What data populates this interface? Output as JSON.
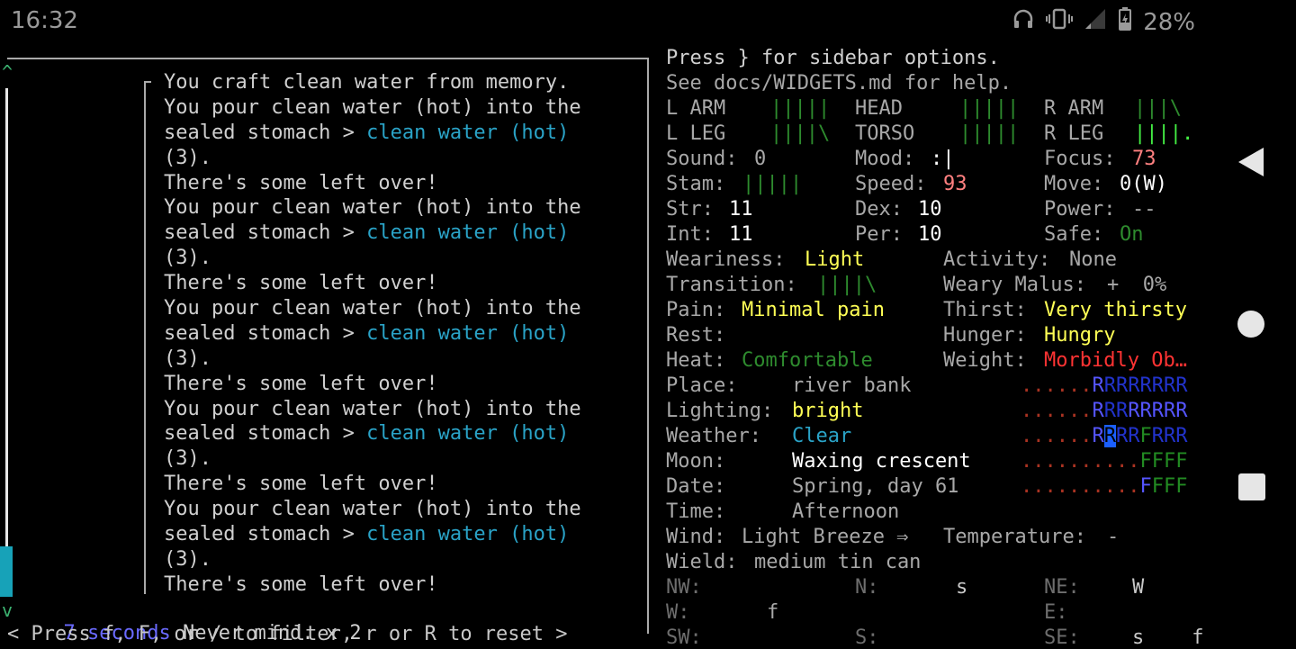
{
  "status": {
    "time": "16:32",
    "battery": "28%"
  },
  "nav": {
    "back": "◀",
    "home": "●",
    "recents": "■"
  },
  "log": {
    "scroll_up": "^",
    "scroll_down": "v",
    "lines": [
      [
        {
          "t": "You craft clean water from memory."
        }
      ],
      [
        {
          "t": "You pour clean water (hot) into the"
        }
      ],
      [
        {
          "t": "sealed stomach > "
        },
        {
          "t": "clean water (hot)",
          "c": "cyan"
        }
      ],
      [
        {
          "t": "(3)."
        }
      ],
      [
        {
          "t": "There's some left over!"
        }
      ],
      [
        {
          "t": "You pour clean water (hot) into the"
        }
      ],
      [
        {
          "t": "sealed stomach > "
        },
        {
          "t": "clean water (hot)",
          "c": "cyan"
        }
      ],
      [
        {
          "t": "(3)."
        }
      ],
      [
        {
          "t": "There's some left over!"
        }
      ],
      [
        {
          "t": "You pour clean water (hot) into the"
        }
      ],
      [
        {
          "t": "sealed stomach > "
        },
        {
          "t": "clean water (hot)",
          "c": "cyan"
        }
      ],
      [
        {
          "t": "(3)."
        }
      ],
      [
        {
          "t": "There's some left over!"
        }
      ],
      [
        {
          "t": "You pour clean water (hot) into the"
        }
      ],
      [
        {
          "t": "sealed stomach > "
        },
        {
          "t": "clean water (hot)",
          "c": "cyan"
        }
      ],
      [
        {
          "t": "(3)."
        }
      ],
      [
        {
          "t": "There's some left over!"
        }
      ],
      [
        {
          "t": "You pour clean water (hot) into the"
        }
      ],
      [
        {
          "t": "sealed stomach > "
        },
        {
          "t": "clean water (hot)",
          "c": "cyan"
        }
      ],
      [
        {
          "t": "(3)."
        }
      ],
      [
        {
          "t": "There's some left over!"
        }
      ]
    ],
    "last_time": "7 seconds",
    "last_message": "Never mind. x 2",
    "filter_hint": "< Press f, F, or / to filter, r or R to reset >"
  },
  "sidebar": {
    "header1": "Press } for sidebar options.",
    "header2": "See docs/WIDGETS.md for help.",
    "body_parts": [
      {
        "label": "L ARM",
        "bar": "|||||",
        "c": "dgreen"
      },
      {
        "label": "HEAD",
        "bar": "|||||",
        "c": "dgreen"
      },
      {
        "label": "R ARM",
        "bar": "|||\\",
        "c": "dgreen"
      },
      {
        "label": "L LEG",
        "bar": "||||\\",
        "c": "dgreen"
      },
      {
        "label": "TORSO",
        "bar": "|||||",
        "c": "dgreen"
      },
      {
        "label": "R LEG",
        "bar": "||||.",
        "c": "bgreen"
      }
    ],
    "sound_label": "Sound:",
    "sound": "0",
    "mood_label": "Mood:",
    "mood": ":|",
    "focus_label": "Focus:",
    "focus": "73",
    "stam_label": "Stam:",
    "stam": "|||||",
    "speed_label": "Speed:",
    "speed": "93",
    "move_label": "Move:",
    "move": "0(W)",
    "str_label": "Str:",
    "str": "11",
    "dex_label": "Dex:",
    "dex": "10",
    "power_label": "Power:",
    "power": "--",
    "int_label": "Int:",
    "int": "11",
    "per_label": "Per:",
    "per": "10",
    "safe_label": "Safe:",
    "safe": "On",
    "weariness_label": "Weariness:",
    "weariness": "Light",
    "activity_label": "Activity:",
    "activity": "None",
    "transition_label": "Transition:",
    "transition": "||||\\",
    "weary_malus_label": "Weary Malus:",
    "weary_malus": "+  0%",
    "pain_label": "Pain:",
    "pain": "Minimal pain",
    "thirst_label": "Thirst:",
    "thirst": "Very thirsty",
    "rest_label": "Rest:",
    "rest": "",
    "hunger_label": "Hunger:",
    "hunger": "Hungry",
    "heat_label": "Heat:",
    "heat": "Comfortable",
    "weight_label": "Weight:",
    "weight": "Morbidly Ob…",
    "place_label": "Place:",
    "place": "river bank",
    "lighting_label": "Lighting:",
    "lighting": "bright",
    "weather_label": "Weather:",
    "weather": "Clear",
    "moon_label": "Moon:",
    "moon": "Waxing crescent",
    "date_label": "Date:",
    "date": "Spring, day 61",
    "time_label": "Time:",
    "time": "Afternoon",
    "wind_label": "Wind:",
    "wind": "Light Breeze ⇒",
    "temp_label": "Temperature:",
    "temp": "-",
    "wield_label": "Wield:",
    "wield": "medium tin can",
    "minimap": [
      [
        {
          "t": "......",
          "c": "brownred"
        },
        {
          "t": "R",
          "c": "blue"
        },
        {
          "t": "RRRRRRR",
          "c": "dblue"
        }
      ],
      [
        {
          "t": "......",
          "c": "brownred"
        },
        {
          "t": "R",
          "c": "blue"
        },
        {
          "t": "RR",
          "c": "dblue"
        },
        {
          "t": "RRRRR",
          "c": "blue"
        }
      ],
      [
        {
          "t": "......",
          "c": "brownred"
        },
        {
          "t": "R",
          "c": "blue"
        },
        {
          "t": "R",
          "c": "cursor"
        },
        {
          "t": "RR",
          "c": "dblue"
        },
        {
          "t": "F",
          "c": "lime"
        },
        {
          "t": "RRR",
          "c": "dblue"
        }
      ],
      [
        {
          "t": "..........",
          "c": "brownred"
        },
        {
          "t": "FFFF",
          "c": "lime"
        }
      ],
      [
        {
          "t": "..........",
          "c": "brownred"
        },
        {
          "t": "F",
          "c": "blue"
        },
        {
          "t": "FFF",
          "c": "lime"
        }
      ]
    ],
    "compass": [
      {
        "dir": "NW:",
        "v": ""
      },
      {
        "dir": "N:",
        "v": "s"
      },
      {
        "dir": "NE:",
        "v": "W"
      },
      {
        "dir": "W:",
        "v": "f"
      },
      {
        "dir": "",
        "v": ""
      },
      {
        "dir": "E:",
        "v": ""
      },
      {
        "dir": "SW:",
        "v": ""
      },
      {
        "dir": "S:",
        "v": ""
      },
      {
        "dir": "SE:",
        "v": "s    f"
      }
    ]
  },
  "colors": {
    "accent": "#17a2b8",
    "terminal_bg": "#000000"
  }
}
